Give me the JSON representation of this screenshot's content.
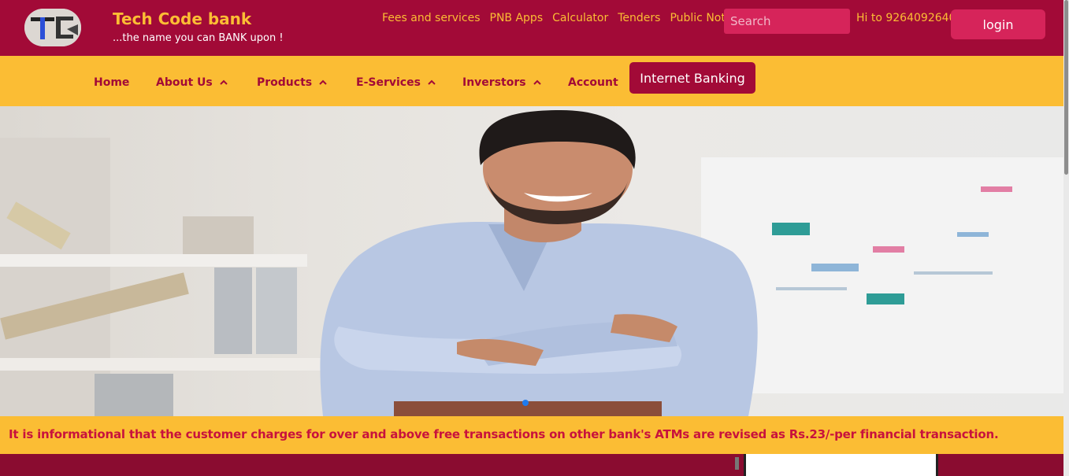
{
  "header": {
    "brand_name": "Tech Code bank",
    "tagline": "...the name you can BANK upon !",
    "links": [
      "Fees and services",
      "PNB Apps",
      "Calculator",
      "Tenders",
      "Public Notices"
    ],
    "search_placeholder": "Search",
    "greeting": "Hi to 9264092640",
    "login_label": "login"
  },
  "nav": {
    "items": [
      {
        "label": "Home",
        "dropdown": false
      },
      {
        "label": "About Us",
        "dropdown": true
      },
      {
        "label": "Products",
        "dropdown": true
      },
      {
        "label": "E-Services",
        "dropdown": true
      },
      {
        "label": "Inverstors",
        "dropdown": true
      },
      {
        "label": "Account",
        "dropdown": false
      }
    ],
    "internet_banking_label": "Internet Banking"
  },
  "hero": {
    "active_slide": 1,
    "slide_count": 1
  },
  "notice": {
    "text": "It is informational that the customer charges for over and above free transactions on other bank's ATMs are revised as Rs.23/-per financial transaction."
  },
  "colors": {
    "maroon": "#a20a37",
    "gold": "#fbbd34",
    "pink": "#d6245a",
    "dot_blue": "#1e7bf0"
  }
}
